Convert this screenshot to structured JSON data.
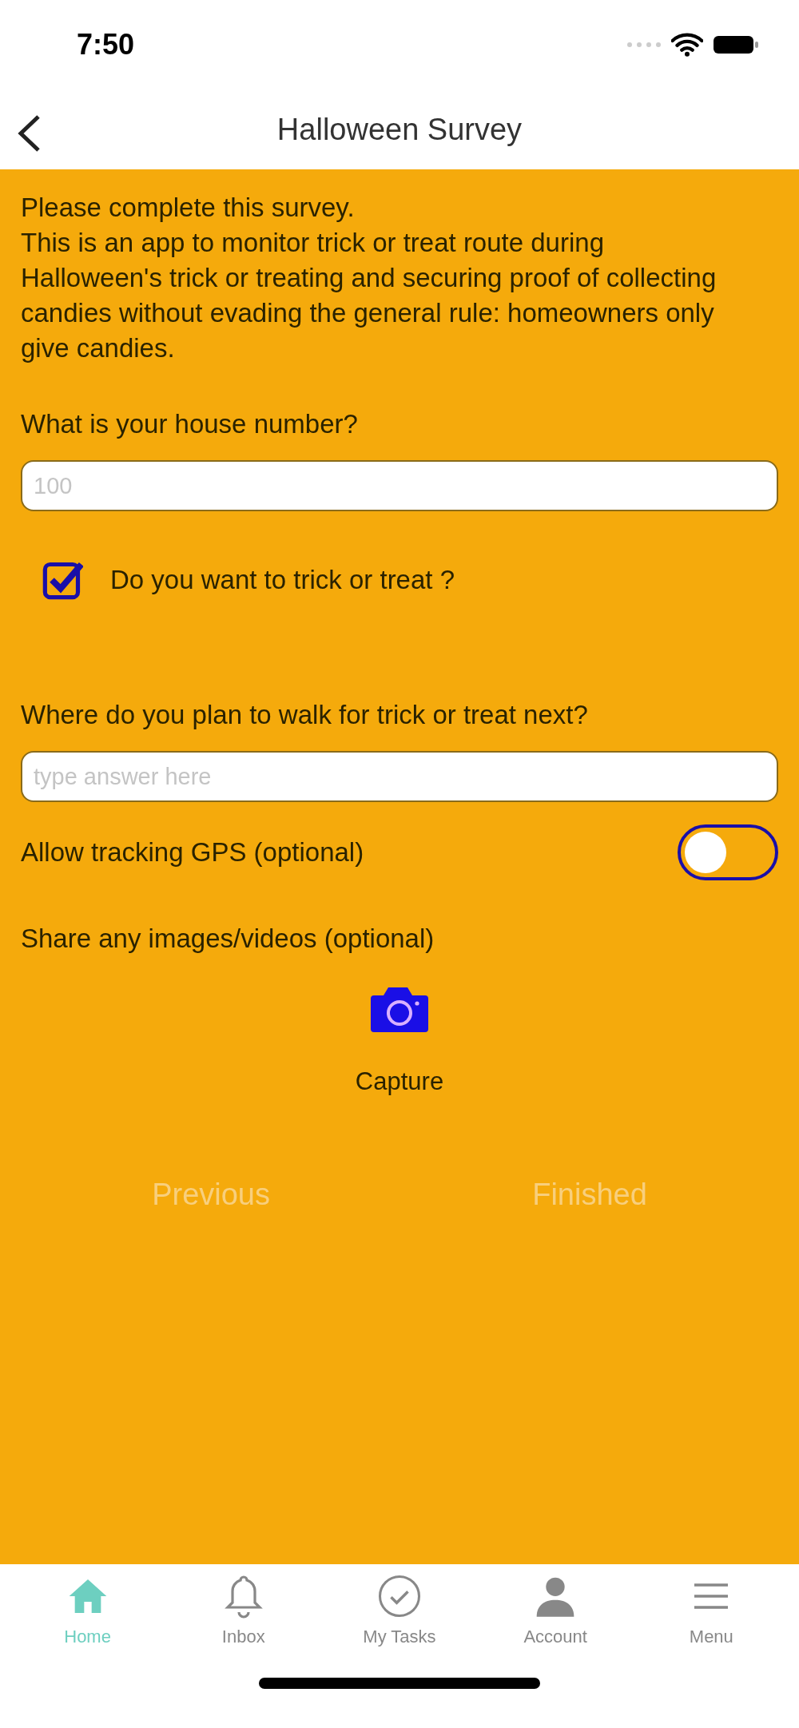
{
  "status_bar": {
    "time": "7:50"
  },
  "nav": {
    "title": "Halloween Survey"
  },
  "intro": [
    "Please complete this survey.",
    "This is an app to monitor trick or treat route during Halloween's trick or treating and securing proof of collecting candies without evading the general rule: homeowners only give candies."
  ],
  "questions": [
    {
      "kind": "text",
      "label": "What is your house number?",
      "placeholder": "100"
    },
    {
      "kind": "checkbox",
      "label": "Do you want to trick or treat ?",
      "checked": true
    },
    {
      "kind": "text",
      "label": "Where do you plan to walk for trick or treat next?",
      "placeholder": "type answer here"
    },
    {
      "kind": "toggle",
      "label": "Allow tracking GPS (optional)",
      "on": false
    },
    {
      "kind": "capture",
      "label": "Share any images/videos (optional)",
      "button": "Capture"
    }
  ],
  "buttons": [
    "Previous",
    "Finished"
  ],
  "tabs": [
    {
      "label": "Home",
      "selected": true,
      "kind": "home"
    },
    {
      "label": "Inbox",
      "selected": false,
      "kind": "bell"
    },
    {
      "label": "My Tasks",
      "selected": false,
      "kind": "check"
    },
    {
      "label": "Account",
      "selected": false,
      "kind": "person"
    },
    {
      "label": "Menu",
      "selected": false,
      "kind": "menu"
    }
  ]
}
